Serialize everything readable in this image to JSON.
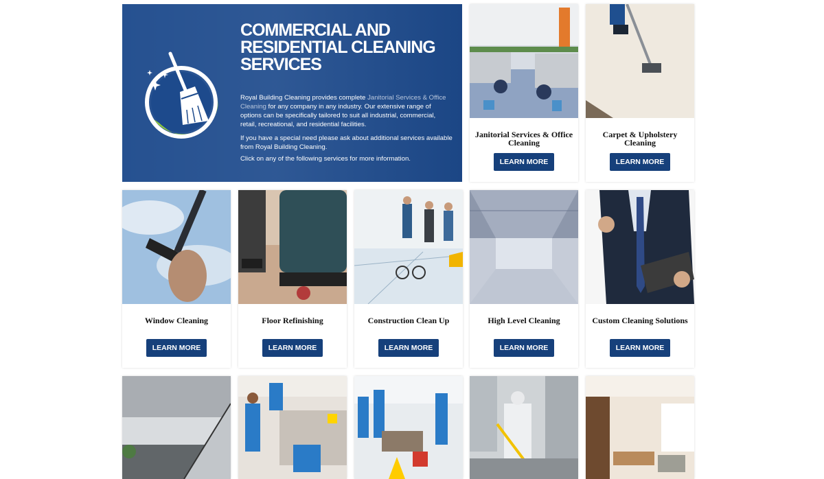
{
  "hero": {
    "title": "COMMERCIAL AND RESIDENTIAL CLEANING SERVICES",
    "intro_before": "Royal Building Cleaning provides complete ",
    "intro_link": "Janitorial Services & Office Cleaning",
    "intro_after": " for any company in any industry. Our extensive range of options can be specifically tailored to suit all industrial, commercial, retail, recreational, and residential facilities.",
    "special_need": "If you have a special need please ask about additional services available from Royal Building Cleaning.",
    "click_note": "Click on any of the following services for more information.",
    "logo_icon": "broom-icon",
    "colors": {
      "background": "#1d4a8c",
      "logo_ring": "#8cc63f"
    }
  },
  "button_color": "#16407b",
  "services": [
    {
      "caption": "Janitorial Services & Office Cleaning",
      "button": "LEARN MORE",
      "photo": "office-cubicles-photo"
    },
    {
      "caption": "Carpet & Upholstery Cleaning",
      "button": "LEARN MORE",
      "photo": "carpet-cleaning-photo"
    },
    {
      "caption": "Window Cleaning",
      "button": "LEARN MORE",
      "photo": "window-squeegee-photo"
    },
    {
      "caption": "Floor Refinishing",
      "button": "LEARN MORE",
      "photo": "floor-machine-photo"
    },
    {
      "caption": "Construction Clean Up",
      "button": "LEARN MORE",
      "photo": "construction-plans-photo"
    },
    {
      "caption": "High Level Cleaning",
      "button": "LEARN MORE",
      "photo": "warehouse-photo"
    },
    {
      "caption": "Custom Cleaning Solutions",
      "button": "LEARN MORE",
      "photo": "businessman-clipboard-photo"
    }
  ],
  "more_photos": [
    "staircase-photo",
    "kitchen-cleaners-photo",
    "office-cleaning-team-photo",
    "industrial-cleaner-photo",
    "lobby-photo"
  ]
}
